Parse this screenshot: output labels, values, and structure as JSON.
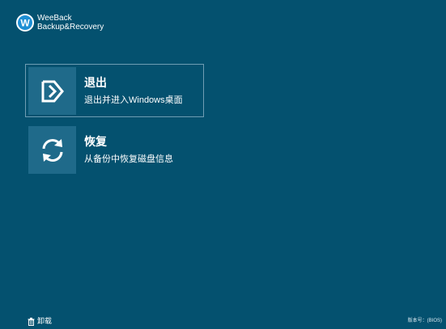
{
  "brand": {
    "line1": "WeeBack",
    "line2": "Backup&Recovery",
    "logo_letter": "W",
    "logo_icon": "weeback-logo-icon"
  },
  "options": [
    {
      "title": "退出",
      "description": "退出并进入Windows桌面",
      "icon": "exit-arrow-icon",
      "selected": true
    },
    {
      "title": "恢复",
      "description": "从备份中恢复磁盘信息",
      "icon": "refresh-icon",
      "selected": false
    }
  ],
  "footer": {
    "uninstall_label": "卸载",
    "uninstall_icon": "trash-icon",
    "version_text": "版本号：(BIOS)"
  },
  "colors": {
    "background": "#04516f",
    "tile": "#1f6a8a",
    "selected_border": "#6f9db3",
    "text": "#ffffff"
  }
}
